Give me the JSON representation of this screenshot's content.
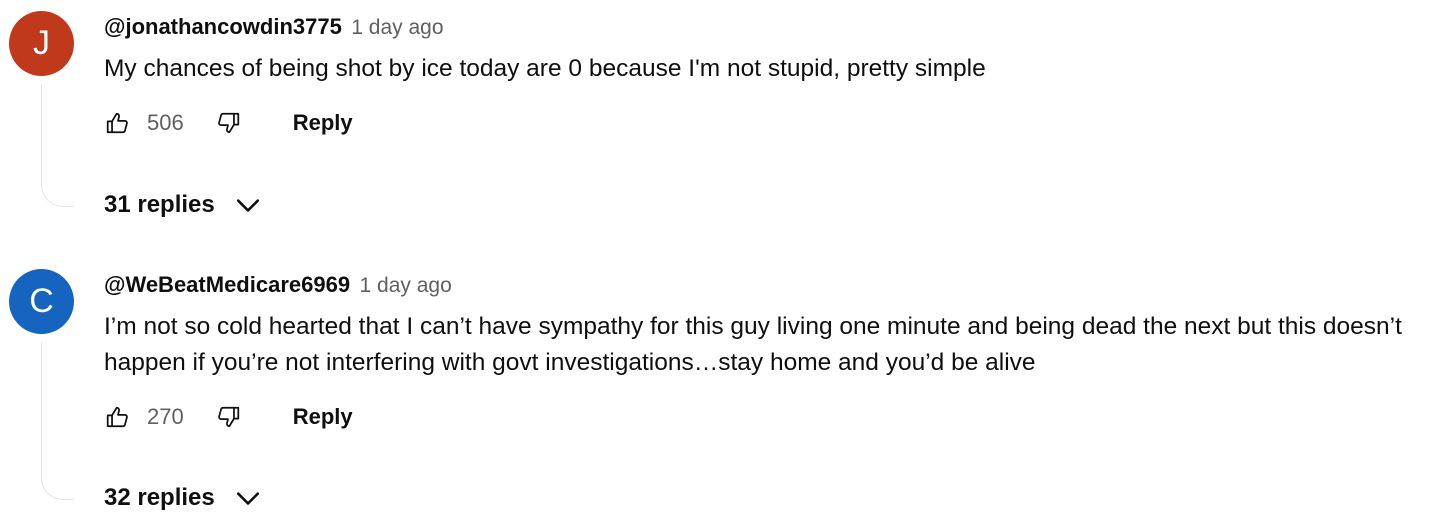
{
  "comments": [
    {
      "avatar_letter": "J",
      "avatar_color": "#c0391b",
      "author": "@jonathancowdin3775",
      "time": "1 day ago",
      "text_lines": [
        "My chances of being shot by ice today are 0 because I'm not stupid, pretty simple"
      ],
      "likes": "506",
      "reply_label": "Reply",
      "replies_label": "31 replies",
      "like_icon": "thumb-up-icon",
      "dislike_icon": "thumb-down-icon",
      "expand_icon": "chevron-down-icon"
    },
    {
      "avatar_letter": "C",
      "avatar_color": "#1565c0",
      "author": "@WeBeatMedicare6969",
      "time": "1 day ago",
      "text_lines": [
        "I’m not so cold hearted that I can’t have sympathy for this guy living one minute and being dead the next but this doesn’t",
        "happen if you’re not interfering with govt investigations…stay home and you’d be alive"
      ],
      "likes": "270",
      "reply_label": "Reply",
      "replies_label": "32 replies",
      "like_icon": "thumb-up-icon",
      "dislike_icon": "thumb-down-icon",
      "expand_icon": "chevron-down-icon"
    }
  ]
}
